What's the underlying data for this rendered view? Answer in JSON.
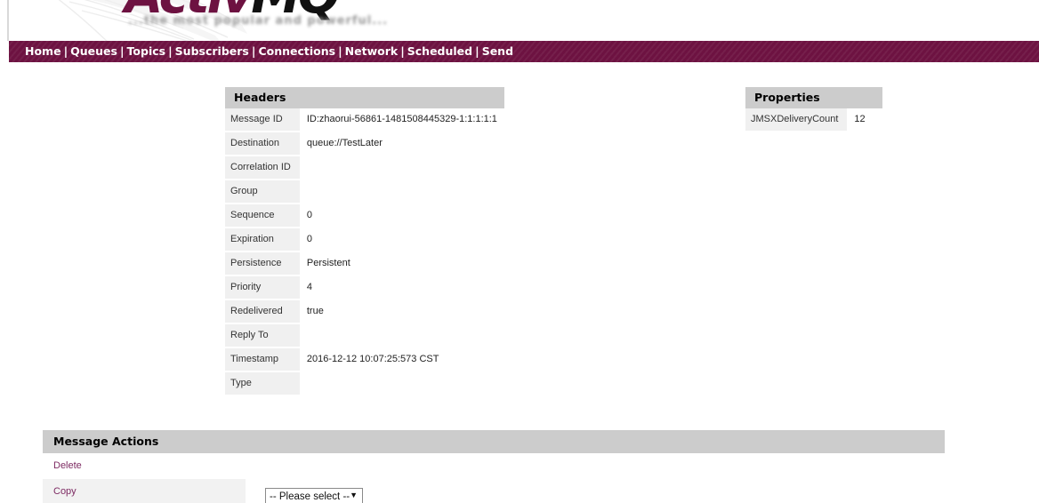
{
  "brand": {
    "logo_primary": "Activ",
    "logo_secondary": "MQ",
    "tagline": "...the most popular and powerful..."
  },
  "nav": {
    "separator": "|",
    "items": [
      {
        "label": "Home",
        "name": "nav-link-home"
      },
      {
        "label": "Queues",
        "name": "nav-link-queues"
      },
      {
        "label": "Topics",
        "name": "nav-link-topics"
      },
      {
        "label": "Subscribers",
        "name": "nav-link-subscribers"
      },
      {
        "label": "Connections",
        "name": "nav-link-connections"
      },
      {
        "label": "Network",
        "name": "nav-link-network"
      },
      {
        "label": "Scheduled",
        "name": "nav-link-scheduled"
      },
      {
        "label": "Send",
        "name": "nav-link-send"
      }
    ]
  },
  "headers": {
    "title": "Headers",
    "rows": [
      {
        "label": "Message ID",
        "value": "ID:zhaorui-56861-1481508445329-1:1:1:1:1"
      },
      {
        "label": "Destination",
        "value": "queue://TestLater"
      },
      {
        "label": "Correlation ID",
        "value": ""
      },
      {
        "label": "Group",
        "value": ""
      },
      {
        "label": "Sequence",
        "value": "0"
      },
      {
        "label": "Expiration",
        "value": "0"
      },
      {
        "label": "Persistence",
        "value": "Persistent"
      },
      {
        "label": "Priority",
        "value": "4"
      },
      {
        "label": "Redelivered",
        "value": "true"
      },
      {
        "label": "Reply To",
        "value": ""
      },
      {
        "label": "Timestamp",
        "value": "2016-12-12 10:07:25:573 CST"
      },
      {
        "label": "Type",
        "value": ""
      }
    ]
  },
  "properties": {
    "title": "Properties",
    "rows": [
      {
        "label": "JMSXDeliveryCount",
        "value": "12"
      }
    ]
  },
  "message_actions": {
    "title": "Message Actions",
    "delete_label": "Delete",
    "copy_label": "Copy",
    "select": {
      "selected": "-- Please select --",
      "caret": "▼",
      "options": [
        "-- Please select --"
      ]
    }
  },
  "colors": {
    "brand_maroon": "#6d1241",
    "nav_background": "#6d1241",
    "link_purple": "#7d2a62",
    "section_header_gray": "#cccccc",
    "label_cell_gray": "#f0f0f0",
    "shade_row_gray": "#f2f2f2"
  }
}
